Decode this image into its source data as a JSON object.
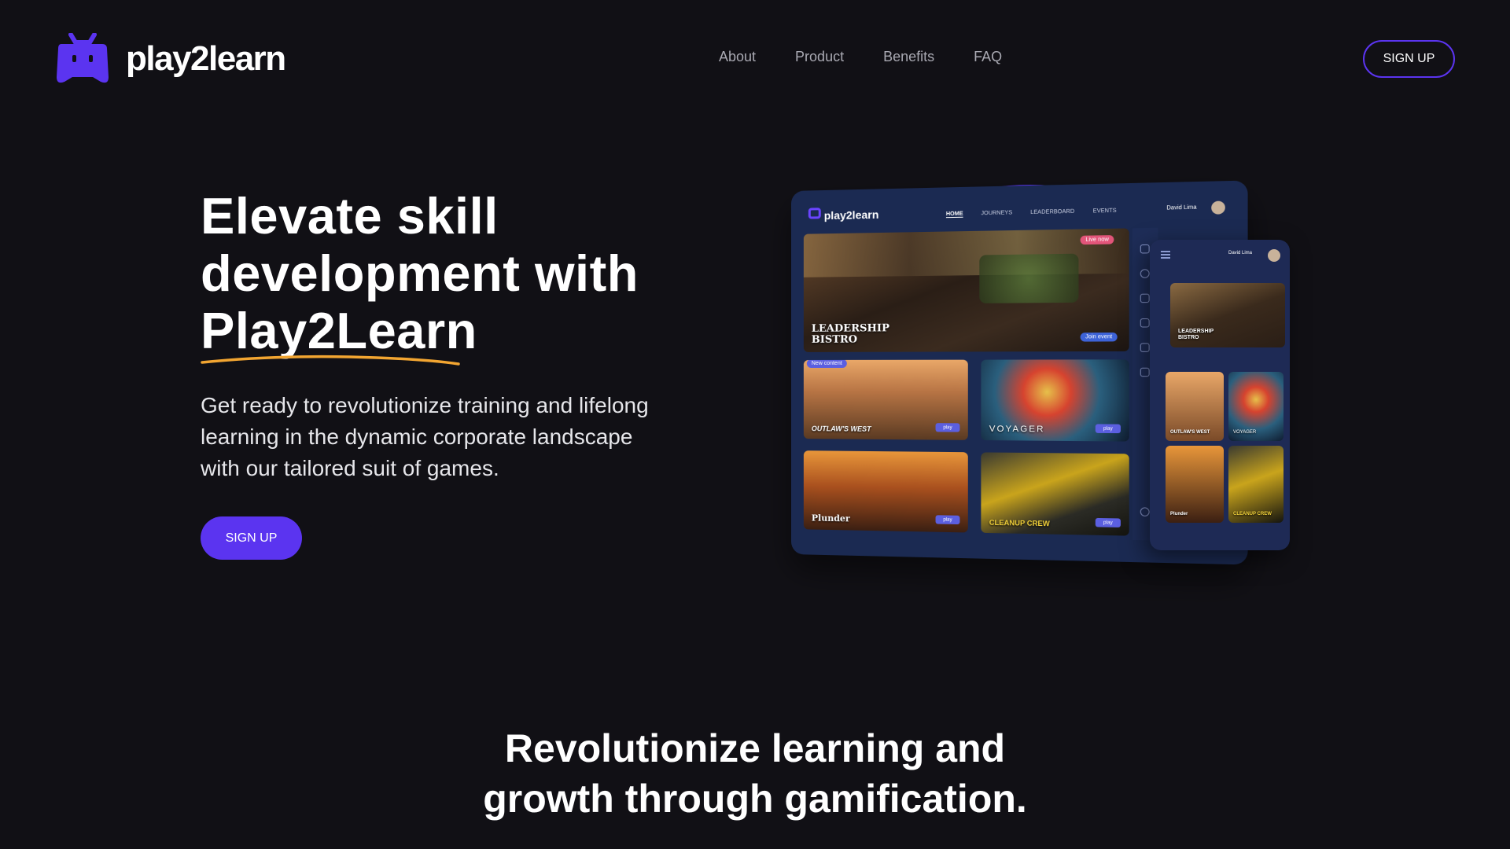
{
  "header": {
    "brand": "play2learn",
    "nav": [
      "About",
      "Product",
      "Benefits",
      "FAQ"
    ],
    "signup_label": "SIGN UP"
  },
  "hero": {
    "title_lines": [
      "Elevate skill",
      "development with",
      "Play2Learn"
    ],
    "subtitle": "Get ready to revolutionize training and lifelong learning in the dynamic corporate landscape with our tailored suit of games.",
    "cta_label": "SIGN UP"
  },
  "mockup": {
    "brand": "play2learn",
    "nav": [
      "HOME",
      "JOURNEYS",
      "LEADERBOARD",
      "EVENTS"
    ],
    "user": "David Lima",
    "live_badge": "Live now",
    "join_label": "Join event",
    "new_badge": "New content",
    "play_label": "play",
    "games": [
      "LEADERSHIP BISTRO",
      "OUTLAW'S WEST",
      "VOYAGER",
      "Plunder",
      "CLEANUP CREW"
    ]
  },
  "colors": {
    "background": "#111015",
    "accent": "#5b34f0",
    "underline": "#f2a531",
    "nav_text": "#a9a9b2"
  },
  "section": {
    "title_lines": [
      "Revolutionize learning and",
      "growth through gamification."
    ]
  }
}
